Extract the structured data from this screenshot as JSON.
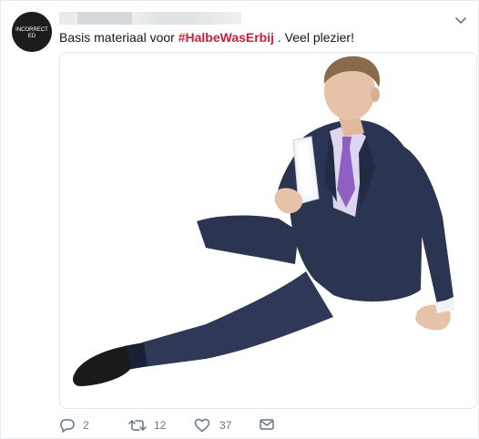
{
  "tweet": {
    "avatar": {
      "name": "avatar",
      "label_line1": "INCORRECT",
      "label_line2": "ED"
    },
    "text": {
      "before": "Basis materiaal voor ",
      "hashtag": "#HalbeWasErbij",
      "after": " . Veel plezier!"
    },
    "actions": {
      "reply": {
        "count": "2",
        "icon": "reply-icon"
      },
      "retweet": {
        "count": "12",
        "icon": "retweet-icon"
      },
      "like": {
        "count": "37",
        "icon": "heart-icon"
      },
      "message": {
        "icon": "envelope-icon"
      }
    },
    "colors": {
      "hashtag": "#c4243b",
      "action_gray": "#657786",
      "border": "#e1e8ed",
      "suit": "#2b3450",
      "tie": "#8f5fc4",
      "shirt": "#dcd7ee"
    }
  }
}
